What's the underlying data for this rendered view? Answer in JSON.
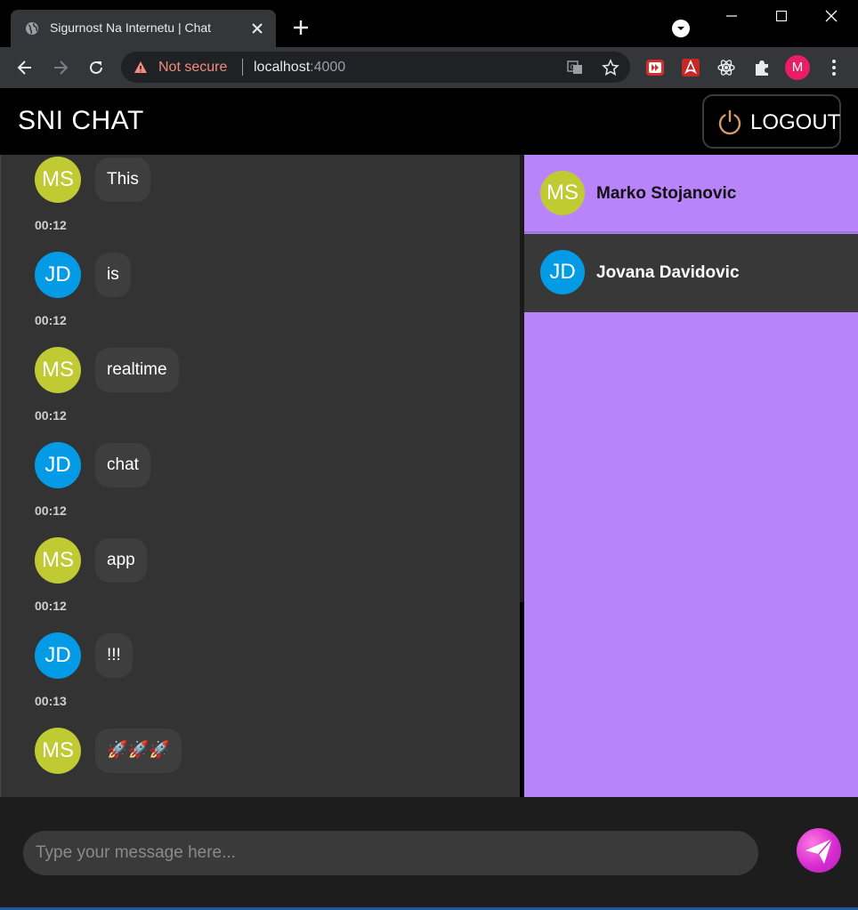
{
  "browser": {
    "tab_title": "Sigurnost Na Internetu | Chat",
    "security_label": "Not secure",
    "url_host": "localhost",
    "url_port": ":4000",
    "profile_initial": "M",
    "colors": {
      "frame": "#000000",
      "toolbar": "#35363a",
      "warning": "#f28b82",
      "profile": "#e91e63"
    }
  },
  "app": {
    "title": "SNI CHAT",
    "logout_label": "LOGOUT",
    "colors": {
      "accent": "#b983fa",
      "logout_icon": "#d79b6a",
      "ms_avatar": "#c0ca33",
      "jd_avatar": "#039be5"
    }
  },
  "messages": [
    {
      "time": "",
      "initials": "MS",
      "text": "This"
    },
    {
      "time": "00:12",
      "initials": "JD",
      "text": "is"
    },
    {
      "time": "00:12",
      "initials": "MS",
      "text": "realtime"
    },
    {
      "time": "00:12",
      "initials": "JD",
      "text": "chat"
    },
    {
      "time": "00:12",
      "initials": "MS",
      "text": "app"
    },
    {
      "time": "00:12",
      "initials": "JD",
      "text": "!!!"
    },
    {
      "time": "00:13",
      "initials": "MS",
      "text": "🚀🚀🚀"
    }
  ],
  "contacts": [
    {
      "initials": "MS",
      "name": "Marko Stojanovic",
      "active": true
    },
    {
      "initials": "JD",
      "name": "Jovana Davidovic",
      "active": false
    }
  ],
  "composer": {
    "placeholder": "Type your message here..."
  }
}
